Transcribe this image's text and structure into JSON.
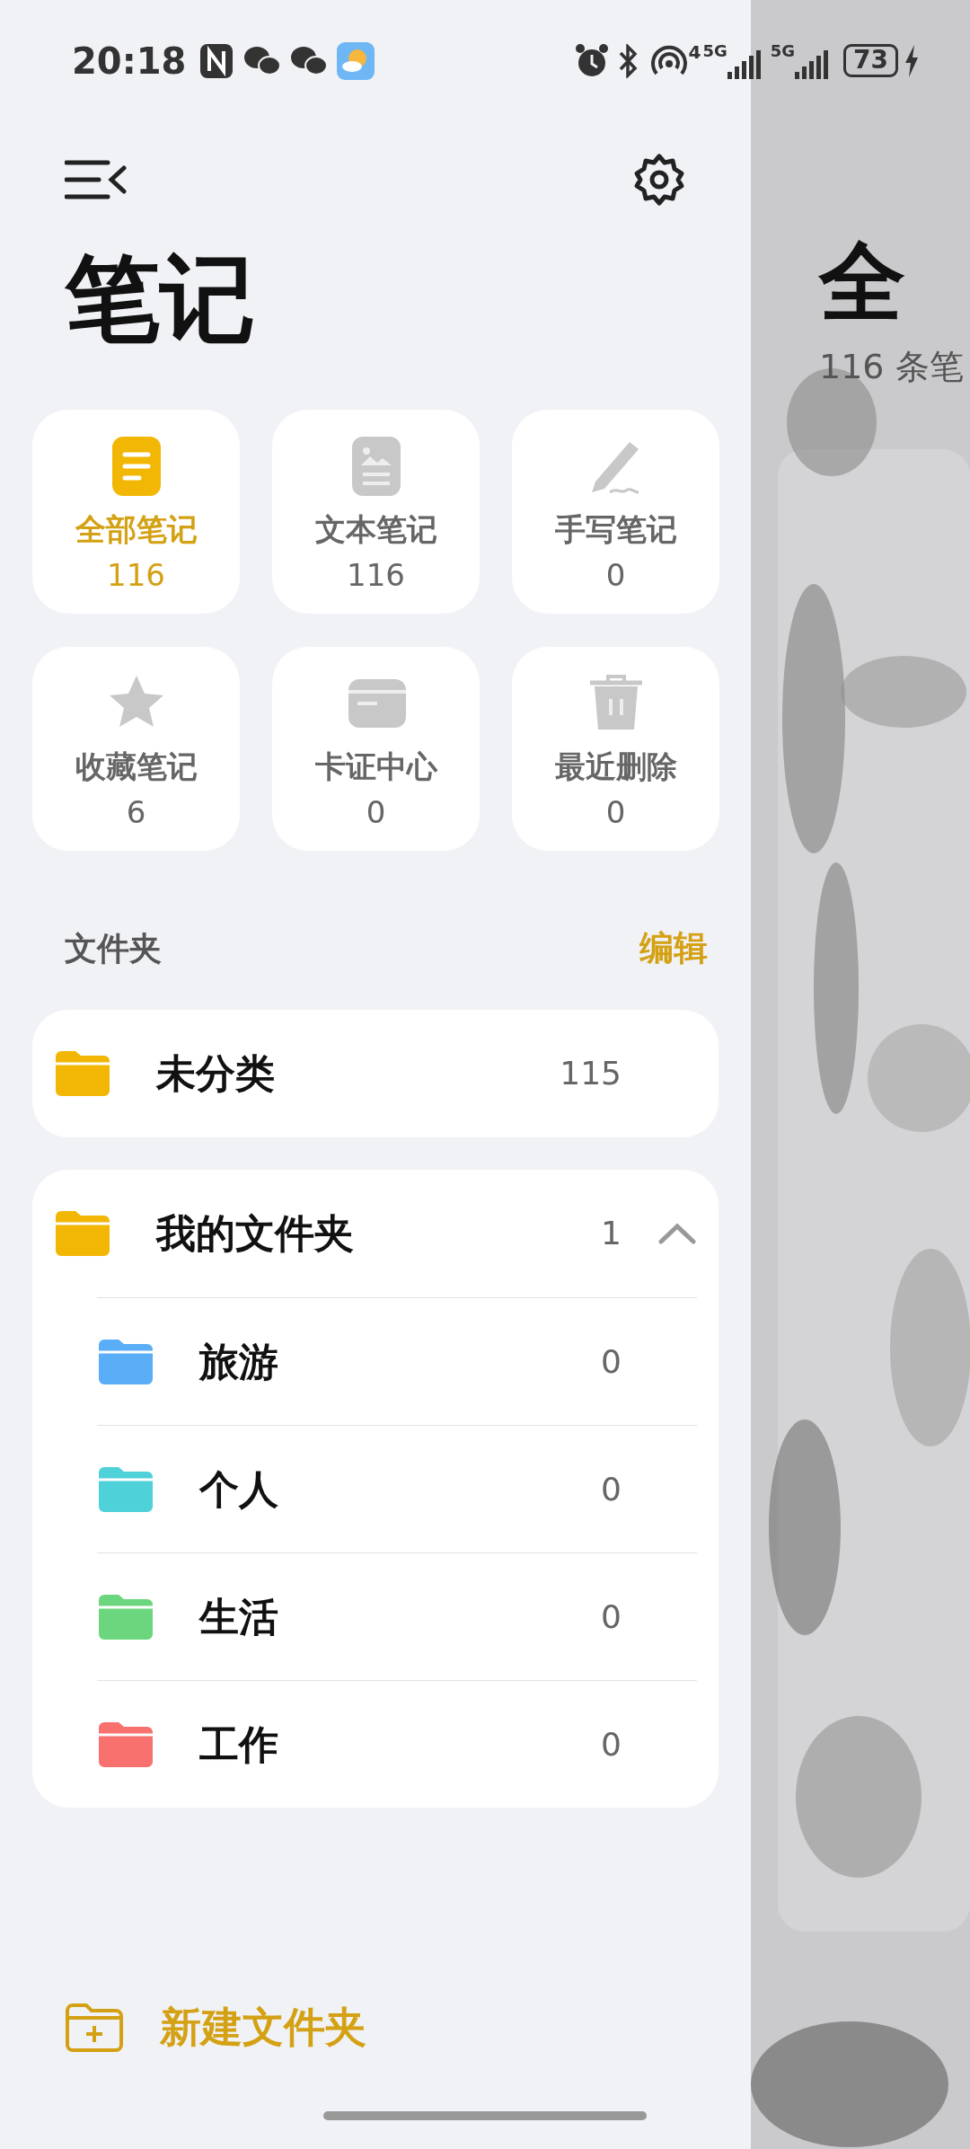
{
  "status_bar": {
    "time": "20:18",
    "network_labels": [
      "4",
      "5G",
      "5G"
    ],
    "battery": "73"
  },
  "title": "笔记",
  "categories": [
    {
      "label": "全部笔记",
      "count": "116",
      "kind": "all",
      "selected": true
    },
    {
      "label": "文本笔记",
      "count": "116",
      "kind": "text",
      "selected": false
    },
    {
      "label": "手写笔记",
      "count": "0",
      "kind": "handwriting",
      "selected": false
    },
    {
      "label": "收藏笔记",
      "count": "6",
      "kind": "favorite",
      "selected": false
    },
    {
      "label": "卡证中心",
      "count": "0",
      "kind": "card",
      "selected": false
    },
    {
      "label": "最近删除",
      "count": "0",
      "kind": "trash",
      "selected": false
    }
  ],
  "folders_section": {
    "title": "文件夹",
    "edit": "编辑"
  },
  "folders": [
    {
      "name": "未分类",
      "count": "115",
      "color": "#f2b705"
    },
    {
      "name": "我的文件夹",
      "count": "1",
      "color": "#f2b705",
      "expanded": true,
      "children": [
        {
          "name": "旅游",
          "count": "0",
          "color": "#5aaef7"
        },
        {
          "name": "个人",
          "count": "0",
          "color": "#4fd1d9"
        },
        {
          "name": "生活",
          "count": "0",
          "color": "#6cd67f"
        },
        {
          "name": "工作",
          "count": "0",
          "color": "#f8716e"
        }
      ]
    }
  ],
  "new_folder": "新建文件夹",
  "behind_panel": {
    "title": "全",
    "subtitle": "116 条笔"
  }
}
